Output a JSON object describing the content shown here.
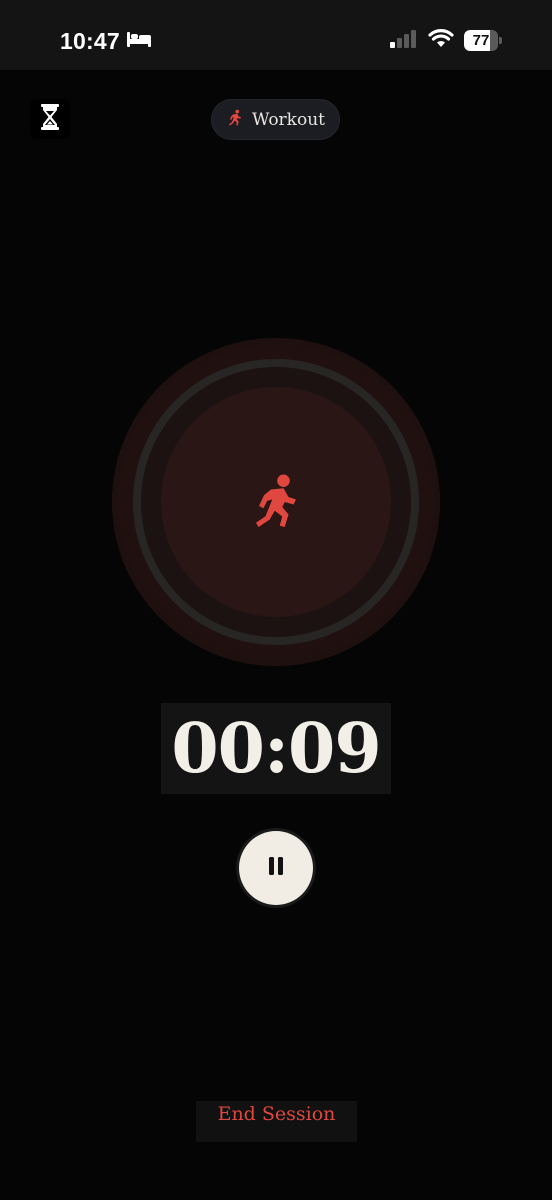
{
  "status_bar": {
    "time": "10:47",
    "focus_icon": "bed-icon",
    "signal_icon": "cellular-signal-icon",
    "wifi_icon": "wifi-icon",
    "battery_level": 77,
    "battery_text": "77"
  },
  "header": {
    "timer_icon": "hourglass-icon",
    "mode": {
      "icon": "running-person-icon",
      "label": "Workout"
    }
  },
  "session": {
    "icon": "running-person-icon",
    "elapsed": "00:09",
    "pause_icon": "pause-icon",
    "end_label": "End Session"
  },
  "colors": {
    "accent": "#e0473f",
    "background": "#050505",
    "timer_text": "#f2efe9",
    "pause_button": "#f1ede5"
  }
}
